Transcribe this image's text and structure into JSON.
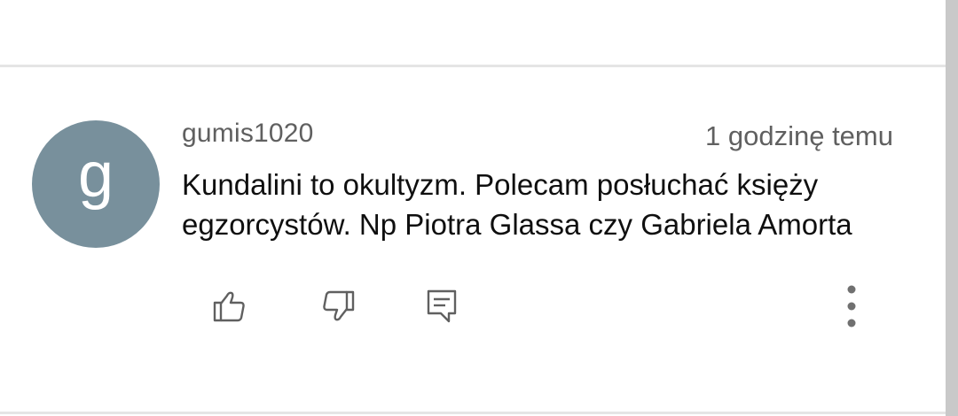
{
  "comment": {
    "avatar_letter": "g",
    "avatar_color": "#78909c",
    "author": "gumis1020",
    "timestamp": "1 godzinę temu",
    "text_line1": "Kundalini to okultyzm. Polecam posłuchać księży",
    "text_line2": "egzorcystów. Np Piotra Glassa czy Gabriela Amorta"
  },
  "actions": {
    "like_icon": "thumbs-up-icon",
    "dislike_icon": "thumbs-down-icon",
    "reply_icon": "reply-comment-icon",
    "more_icon": "more-vertical-icon"
  },
  "colors": {
    "divider": "#e5e5e5",
    "scrollbar": "#c9c9c9",
    "icon": "#606060",
    "text": "#0f0f0f",
    "meta": "#606060"
  }
}
